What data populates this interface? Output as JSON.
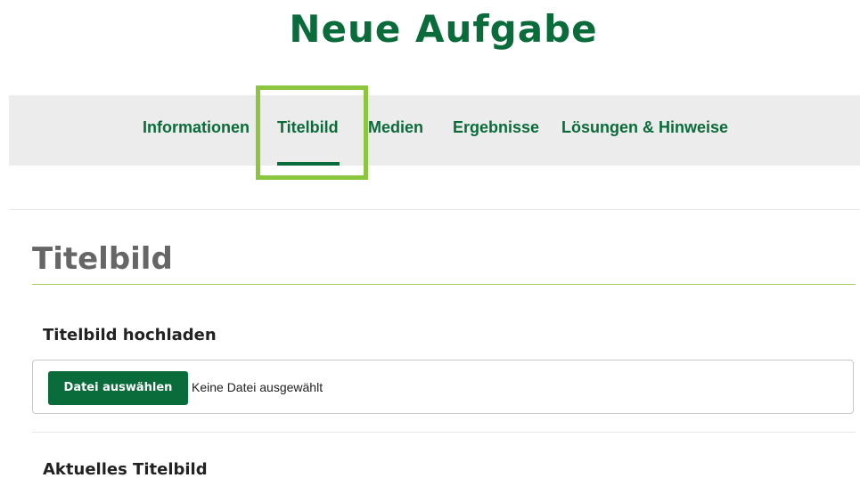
{
  "page": {
    "title": "Neue Aufgabe"
  },
  "tabs": [
    {
      "label": "Informationen",
      "active": false
    },
    {
      "label": "Titelbild",
      "active": true
    },
    {
      "label": "Medien",
      "active": false
    },
    {
      "label": "Ergebnisse",
      "active": false
    },
    {
      "label": "Lösungen & Hinweise",
      "active": false
    }
  ],
  "section": {
    "title": "Titelbild",
    "upload_heading": "Titelbild hochladen",
    "file_button_label": "Datei auswählen",
    "file_status": "Keine Datei ausgewählt",
    "current_heading": "Aktuelles Titelbild"
  },
  "colors": {
    "brand_green": "#0a6b3b",
    "highlight_green": "#8cc63f",
    "tabbar_bg": "#ececec",
    "section_title_gray": "#666666"
  }
}
